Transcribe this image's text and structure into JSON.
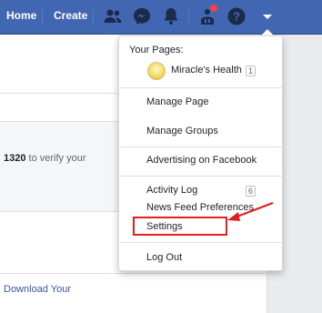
{
  "topbar": {
    "home_label": "Home",
    "create_label": "Create",
    "icons": [
      "friends-icon",
      "messenger-icon",
      "notifications-icon",
      "pages-icon",
      "help-icon",
      "account-menu-icon"
    ],
    "brand_color": "#4267b2"
  },
  "background": {
    "verify_text_number": "1320",
    "verify_text_rest": " to verify your",
    "download_link": "Download Your"
  },
  "menu": {
    "heading": "Your Pages:",
    "page_name": "Miracle's Health",
    "page_count": "1",
    "items": [
      {
        "label": "Manage Page"
      },
      {
        "label": "Manage Groups"
      },
      {
        "label": "Advertising on Facebook"
      },
      {
        "label": "Activity Log",
        "count": "6"
      },
      {
        "label": "News Feed Preferences"
      },
      {
        "label": "Settings"
      },
      {
        "label": "Log Out"
      }
    ]
  },
  "annotation": {
    "highlight_color": "#e02020"
  }
}
